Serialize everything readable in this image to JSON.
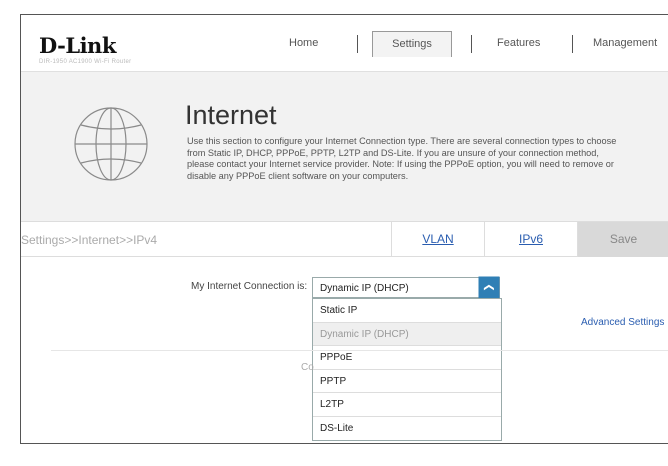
{
  "brand": {
    "logo": "D-Link",
    "model": "DIR-1950 AC1900 Wi-Fi Router"
  },
  "nav": {
    "home": "Home",
    "settings": "Settings",
    "features": "Features",
    "management": "Management"
  },
  "banner": {
    "title": "Internet",
    "description": "Use this section to configure your Internet Connection type. There are several connection types to choose\nfrom Static IP, DHCP, PPPoE, PPTP, L2TP and DS-Lite. If you are unsure of your connection method,\nplease contact your Internet service provider. Note: If using the PPPoE option, you will need to remove or\ndisable any PPPoE client software on your computers."
  },
  "breadcrumb": "Settings>>Internet>>IPv4",
  "tabs": {
    "vlan": "VLAN",
    "ipv6": "IPv6",
    "save": "Save"
  },
  "form": {
    "connection_label": "My Internet Connection is:",
    "connection_value": "Dynamic IP (DHCP)",
    "options": [
      "Static IP",
      "Dynamic IP (DHCP)",
      "PPPoE",
      "PPTP",
      "L2TP",
      "DS-Lite"
    ],
    "selected_index": 1,
    "advanced_link": "Advanced Settings",
    "partial_text": "Co"
  },
  "colors": {
    "accent": "#2f7fb5",
    "link": "#2a5db0",
    "banner_bg": "#f2f2f2"
  }
}
